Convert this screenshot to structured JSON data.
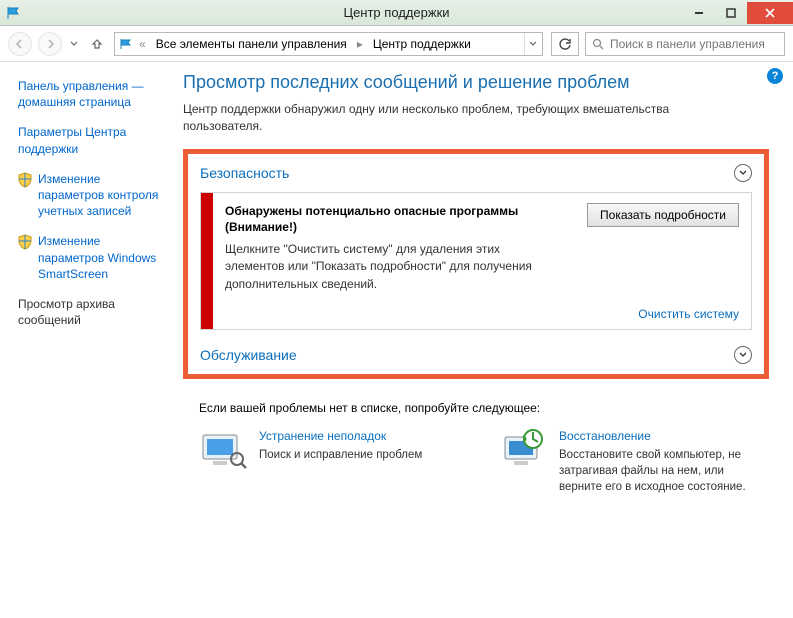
{
  "window": {
    "title": "Центр поддержки"
  },
  "breadcrumb": {
    "item1": "Все элементы панели управления",
    "item2": "Центр поддержки"
  },
  "search": {
    "placeholder": "Поиск в панели управления"
  },
  "sidebar": {
    "home": "Панель управления — домашняя страница",
    "settings": "Параметры Центра поддержки",
    "uac": "Изменение параметров контроля учетных записей",
    "smartscreen": "Изменение параметров Windows SmartScreen",
    "archive": "Просмотр архива сообщений"
  },
  "page": {
    "title": "Просмотр последних сообщений и решение проблем",
    "subtitle": "Центр поддержки обнаружил одну или несколько проблем, требующих вмешательства пользователя."
  },
  "sections": {
    "security": "Безопасность",
    "maintenance": "Обслуживание"
  },
  "alert": {
    "title": "Обнаружены потенциально опасные программы (Внимание!)",
    "text": "Щелкните \"Очистить систему\" для удаления этих элементов или \"Показать подробности\" для получения дополнительных сведений.",
    "details_btn": "Показать подробности",
    "clean_link": "Очистить систему"
  },
  "tips": {
    "intro": "Если вашей проблемы нет в списке, попробуйте следующее:",
    "troubleshoot": {
      "title": "Устранение неполадок",
      "text": "Поиск и исправление проблем"
    },
    "recovery": {
      "title": "Восстановление",
      "text": "Восстановите свой компьютер, не затрагивая файлы на нем, или верните его в исходное состояние."
    }
  }
}
